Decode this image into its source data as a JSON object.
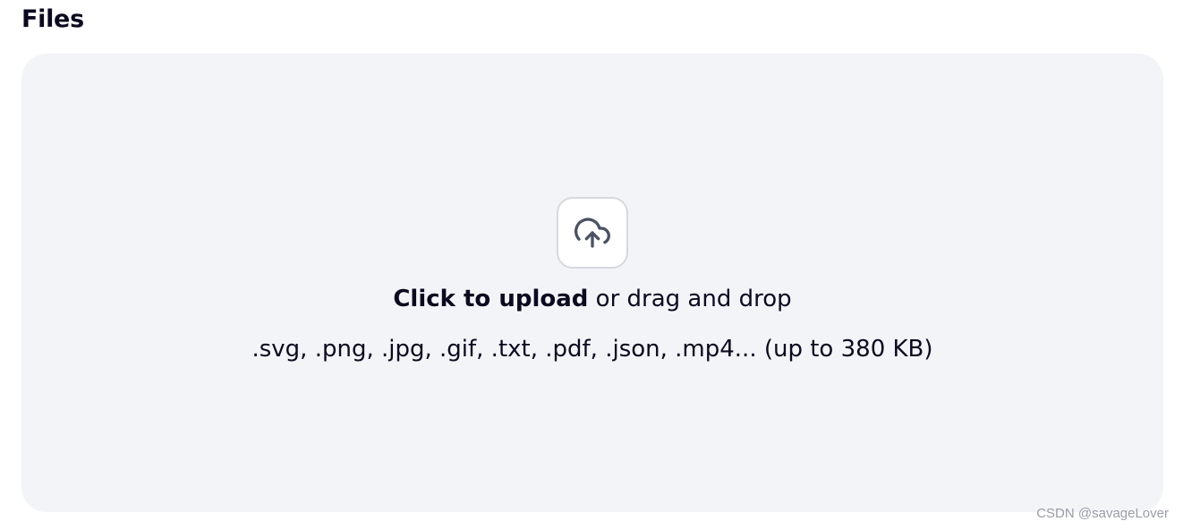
{
  "section": {
    "title": "Files"
  },
  "dropzone": {
    "icon": "cloud-upload-icon",
    "cta_label": "Click to upload",
    "secondary_label": " or drag and drop",
    "formats_hint": ".svg, .png, .jpg, .gif, .txt, .pdf, .json, .mp4... (up to 380 KB)"
  },
  "colors": {
    "dropzone_background": "#f3f4f8",
    "icon_stroke": "#4a5263",
    "text": "#0b0a1f"
  },
  "watermark": "CSDN @savageLover"
}
